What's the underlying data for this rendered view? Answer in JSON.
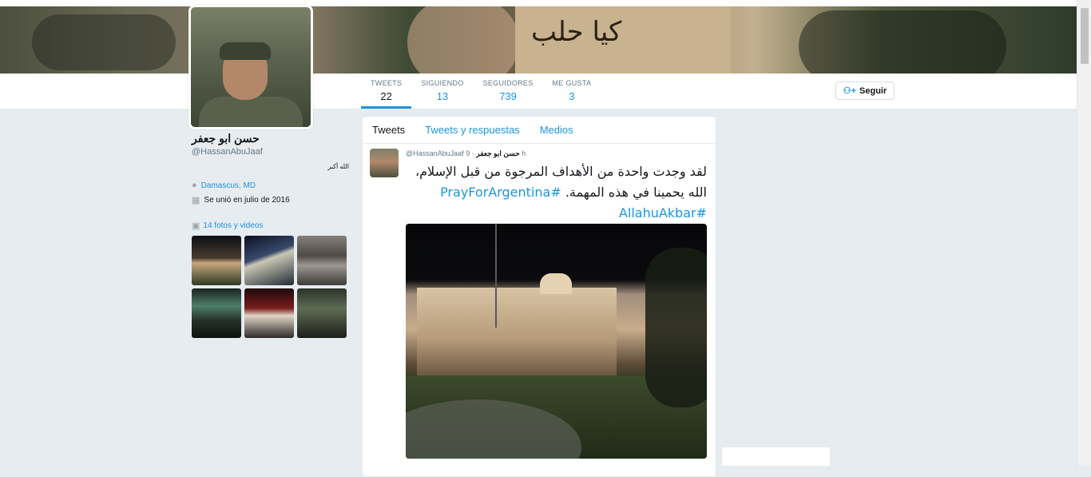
{
  "banner": {
    "card_text": "كيا حلب"
  },
  "profile": {
    "name": "حسن ابو جعفر",
    "handle": "@HassanAbuJaaf",
    "bio": "الله أكبر",
    "location": "Damascus, MD",
    "joined": "Se unió en julio de 2016",
    "photos_label": "14 fotos y videos"
  },
  "stats": [
    {
      "label": "TWEETS",
      "value": "22"
    },
    {
      "label": "SIGUIENDO",
      "value": "13"
    },
    {
      "label": "SEGUIDORES",
      "value": "739"
    },
    {
      "label": "ME GUSTA",
      "value": "3"
    }
  ],
  "follow_button": {
    "label": "Seguir",
    "icon": "add-user-icon"
  },
  "tabs": [
    "Tweets",
    "Tweets y respuestas",
    "Medios"
  ],
  "tweet": {
    "author_name": "حسن ابو جعفر",
    "author_handle": "@HassanAbuJaaf",
    "separator": "·",
    "time": "9 h",
    "text": "لقد وجدت واحدة من الأهداف المرجوة من قبل الإسلام، الله يحمينا في هذه المهمة.",
    "hashtags": [
      "#PrayForArgentina",
      "#AllahuAkbar"
    ]
  },
  "icons": {
    "location": "map-pin-icon",
    "joined": "calendar-icon",
    "photos": "camera-icon"
  },
  "colors": {
    "accent": "#1b95e0",
    "background": "#e6ecf0",
    "text": "#14171a",
    "muted": "#657786"
  }
}
